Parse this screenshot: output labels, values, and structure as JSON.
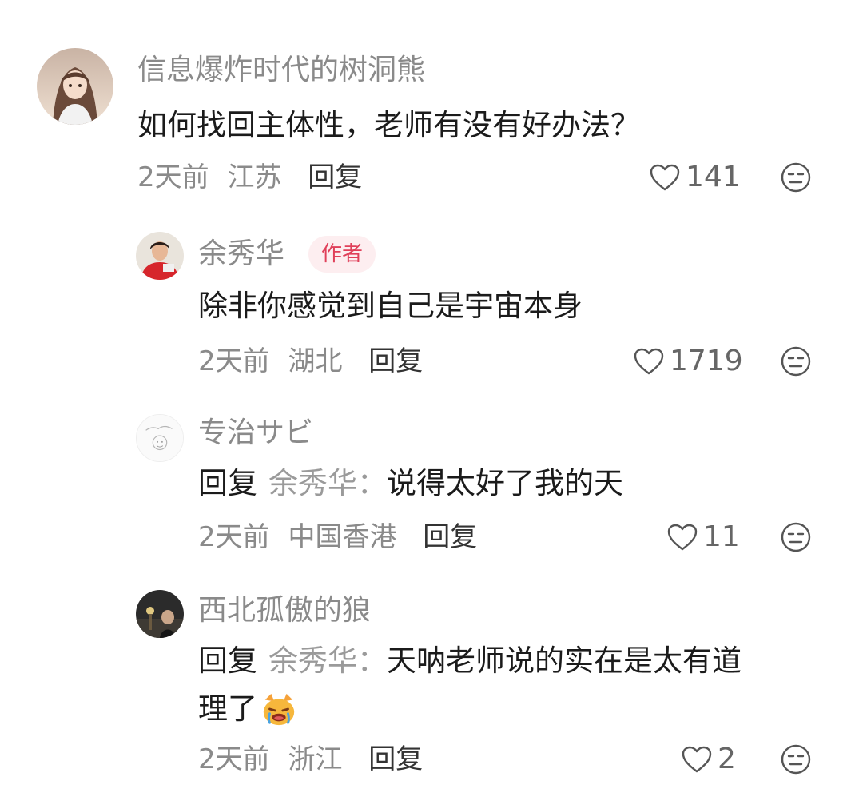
{
  "comments": [
    {
      "username": "信息爆炸时代的树洞熊",
      "text": "如何找回主体性，老师有没有好办法？",
      "time": "2天前",
      "location": "江苏",
      "reply_label": "回复",
      "likes": "141",
      "avatar_icon": "girl-portrait-avatar",
      "like_icon": "heart-outline-icon",
      "dislike_icon": "meh-face-icon"
    },
    {
      "username": "余秀华",
      "badge": "作者",
      "text": "除非你感觉到自己是宇宙本身",
      "time": "2天前",
      "location": "湖北",
      "reply_label": "回复",
      "likes": "1719",
      "avatar_icon": "woman-red-shirt-avatar",
      "like_icon": "heart-outline-icon",
      "dislike_icon": "meh-face-icon"
    },
    {
      "username": "专治サビ",
      "reply_prefix": "回复",
      "reply_target": "余秀华：",
      "text": "说得太好了我的天",
      "time": "2天前",
      "location": "中国香港",
      "reply_label": "回复",
      "likes": "11",
      "avatar_icon": "sketch-avatar",
      "like_icon": "heart-outline-icon",
      "dislike_icon": "meh-face-icon"
    },
    {
      "username": "西北孤傲的狼",
      "reply_prefix": "回复",
      "reply_target": "余秀华：",
      "text_line1": "天呐老师说的实在是太有道",
      "text_line2": "理了",
      "emoji": "crying-cat-emoji",
      "time": "2天前",
      "location": "浙江",
      "reply_label": "回复",
      "likes": "2",
      "avatar_icon": "night-street-avatar",
      "like_icon": "heart-outline-icon",
      "dislike_icon": "meh-face-icon"
    }
  ],
  "colors": {
    "username": "#8a8a8a",
    "text": "#1b1b1b",
    "badge_text": "#e0405a",
    "badge_bg": "#fdeef0"
  }
}
